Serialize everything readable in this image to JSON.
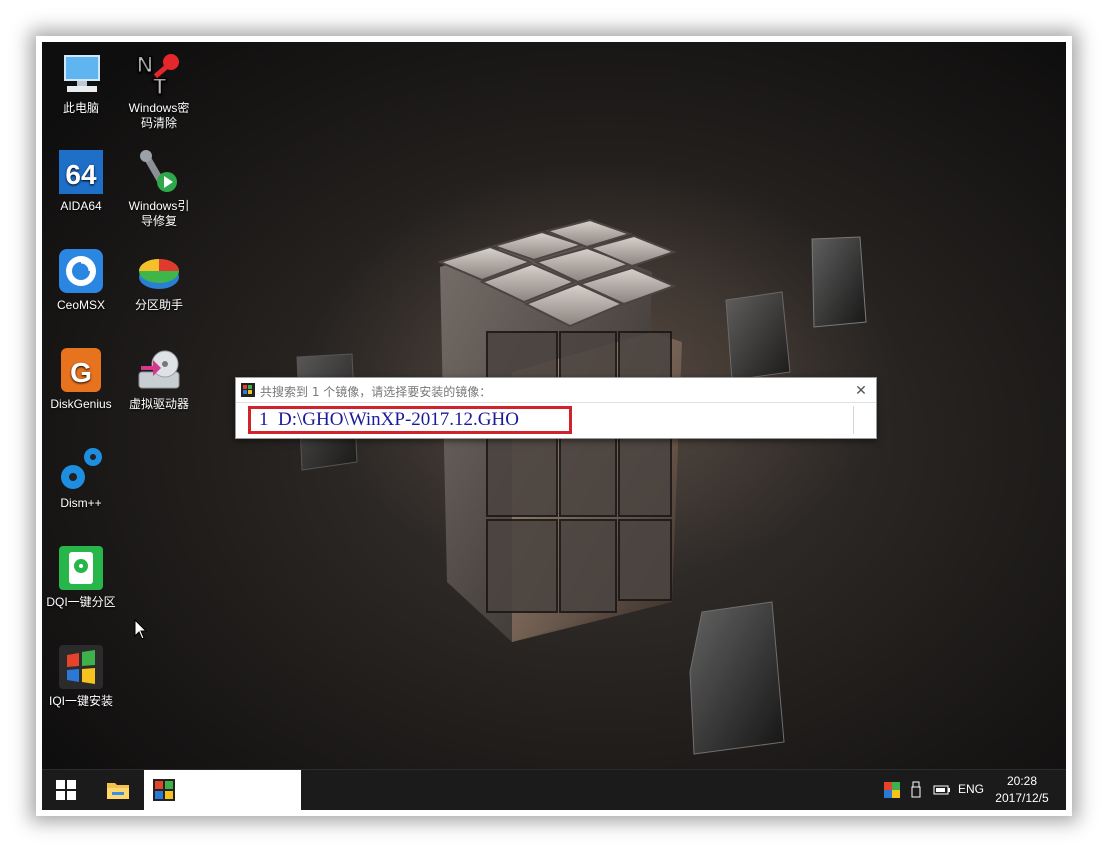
{
  "desktop": {
    "icons": [
      {
        "label": "此电脑",
        "icon": "this-pc-icon"
      },
      {
        "label": "Windows密码清除",
        "line1": "Windows密",
        "line2": "码清除",
        "icon": "nt-password-icon"
      },
      {
        "label": "AIDA64",
        "icon": "aida64-icon"
      },
      {
        "label": "Windows引导修复",
        "line1": "Windows引",
        "line2": "导修复",
        "icon": "boot-repair-icon"
      },
      {
        "label": "CeoMSX",
        "icon": "ceomsx-icon"
      },
      {
        "label": "分区助手",
        "icon": "partition-assistant-icon"
      },
      {
        "label": "DiskGenius",
        "icon": "diskgenius-icon"
      },
      {
        "label": "虚拟驱动器",
        "icon": "virtual-drive-icon"
      },
      {
        "label": "Dism++",
        "icon": "dism-gears-icon"
      },
      {
        "label": "DQI一键分区",
        "icon": "dqi-partition-icon"
      },
      {
        "label": "IQI一键安装",
        "icon": "iqi-install-icon"
      }
    ]
  },
  "dialog": {
    "title": "共搜索到 1 个镜像，请选择要安装的镜像：",
    "close_glyph": "✕",
    "items": [
      {
        "index": "1",
        "path": "D:\\GHO\\WinXP-2017.12.GHO",
        "text": "1  D:\\GHO\\WinXP-2017.12.GHO"
      }
    ]
  },
  "taskbar": {
    "language": "ENG",
    "time": "20:28",
    "date": "2017/12/5"
  },
  "colors": {
    "highlight_border": "#d0232b",
    "list_text": "#1a1a9a",
    "taskbar_bg": "#1b1b1b"
  }
}
